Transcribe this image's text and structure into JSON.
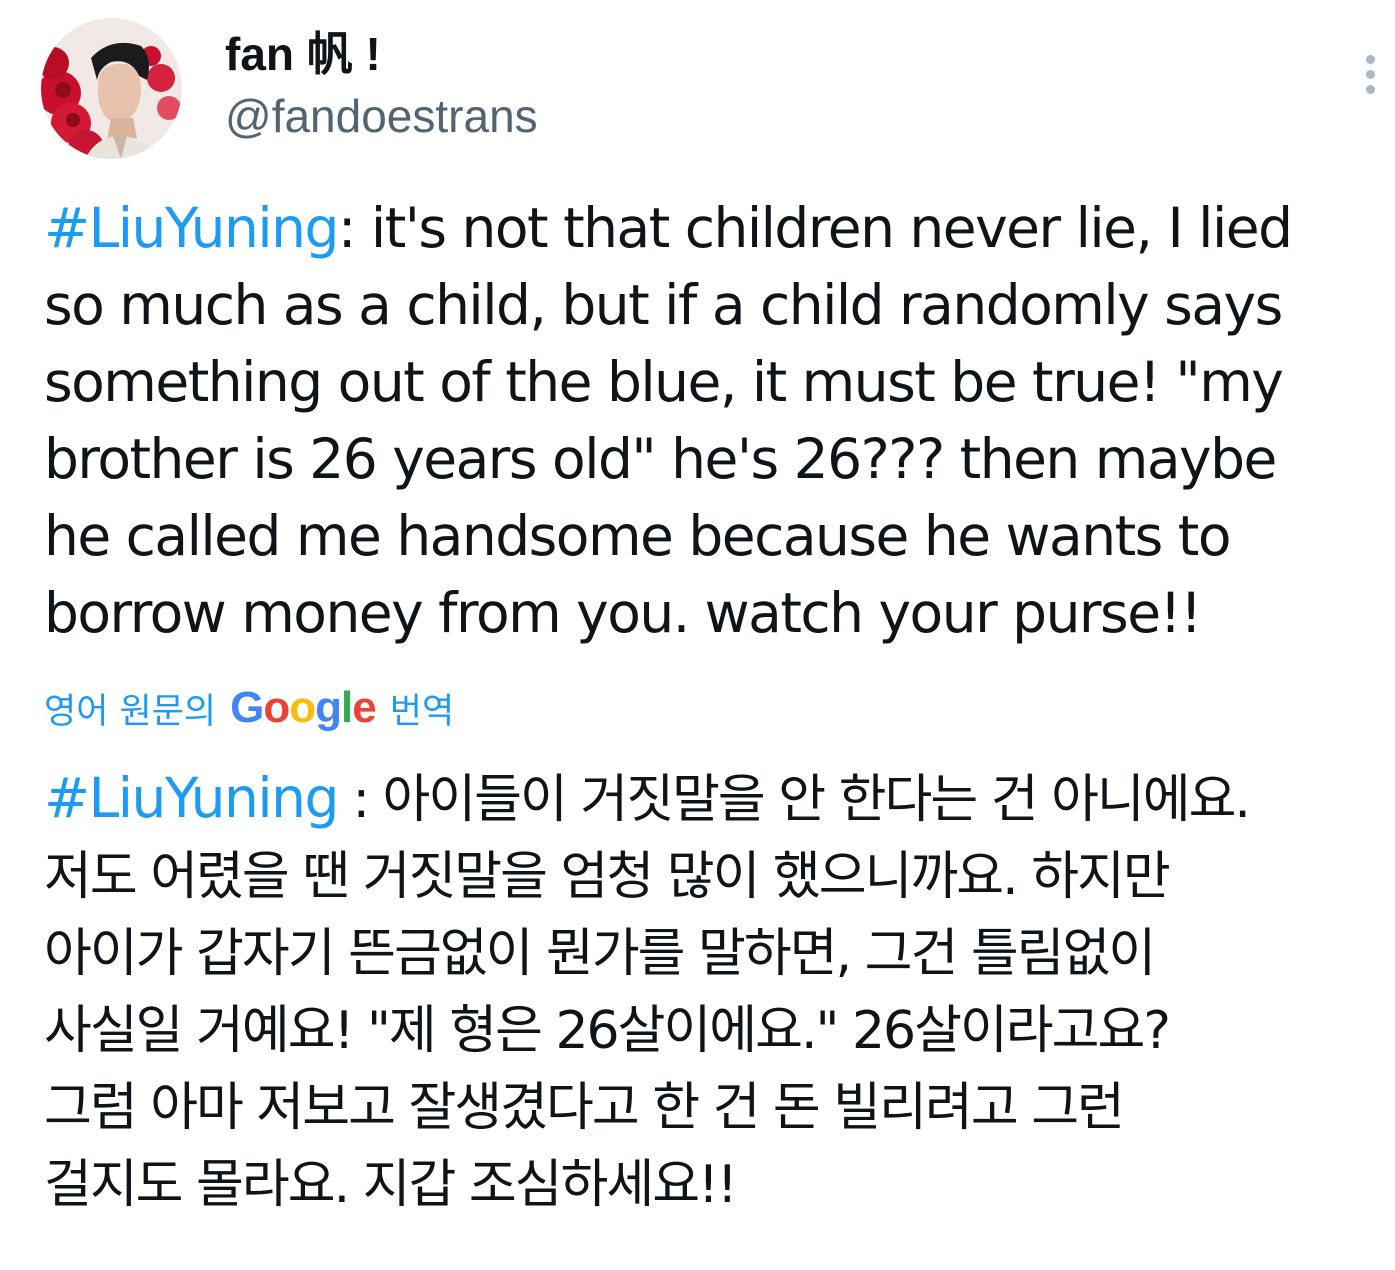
{
  "author": {
    "display_name": "fan 帆 !",
    "handle": "@fandoestrans",
    "avatar_icon": "profile-photo"
  },
  "menu": {
    "icon": "more-vertical-icon"
  },
  "tweet": {
    "hashtag": "#LiuYuning",
    "lines": [
      ": it's not that children never lie, I lied",
      "so much as a child, but if a child randomly says",
      "something out of the blue, it must be true! \"my",
      "brother is 26 years old\" he's 26??? then maybe",
      "he called me handsome because he wants to",
      "borrow money from you. watch your purse!!"
    ]
  },
  "translation": {
    "prefix": "영어 원문의",
    "google": [
      "G",
      "o",
      "o",
      "g",
      "l",
      "e"
    ],
    "google_colors": [
      "#4285f4",
      "#ea4335",
      "#fbbc05",
      "#4285f4",
      "#34a853",
      "#ea4335"
    ],
    "suffix": "번역",
    "hashtag": "#LiuYuning",
    "lines": [
      " : 아이들이 거짓말을 안 한다는 건 아니에요.",
      "저도 어렸을 땐 거짓말을 엄청 많이 했으니까요. 하지만",
      "아이가 갑자기 뜬금없이 뭔가를 말하면, 그건 틀림없이",
      "사실일 거예요! \"제 형은 26살이에요.\" 26살이라고요?",
      "그럼 아마 저보고 잘생겼다고 한 건 돈 빌리려고 그런",
      "걸지도 몰라요. 지갑 조심하세요!!"
    ]
  },
  "colors": {
    "link": "#1d9bf0",
    "text": "#0f1419",
    "secondary": "#536471"
  }
}
